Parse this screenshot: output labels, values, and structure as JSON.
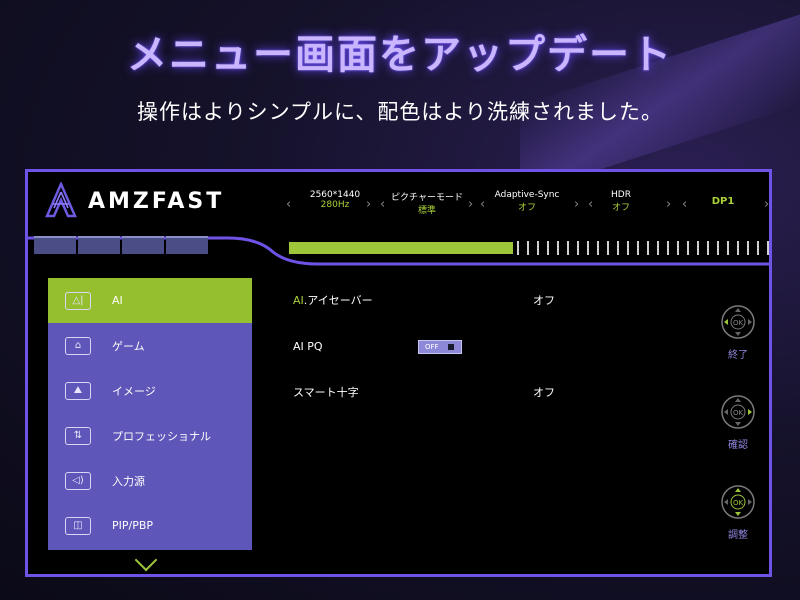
{
  "header": {
    "title": "メニュー画面をアップデート",
    "subtitle": "操作はよりシンプルに、配色はより洗練されました。"
  },
  "osd": {
    "brand": "AMZFAST",
    "status": [
      {
        "top": "2560*1440",
        "sub": "280Hz"
      },
      {
        "top": "ピクチャーモード",
        "sub": "標準"
      },
      {
        "top": "Adaptive-Sync",
        "sub": "オフ"
      },
      {
        "top": "HDR",
        "sub": "オフ"
      },
      {
        "top": "DP1",
        "sub": ""
      }
    ],
    "menu": [
      {
        "label": "AI",
        "icon": "ai-icon",
        "active": true
      },
      {
        "label": "ゲーム",
        "icon": "gamepad-icon",
        "active": false
      },
      {
        "label": "イメージ",
        "icon": "image-icon",
        "active": false
      },
      {
        "label": "プロフェッショナル",
        "icon": "professional-icon",
        "active": false
      },
      {
        "label": "入力源",
        "icon": "input-source-icon",
        "active": false
      },
      {
        "label": "PIP/PBP",
        "icon": "pip-pbp-icon",
        "active": false
      }
    ],
    "settings": [
      {
        "label": "AI.アイセーバー",
        "label_prefix": "AI",
        "label_rest": ".アイセーバー",
        "value": "オフ"
      },
      {
        "label": "AI PQ",
        "value": "OFF"
      },
      {
        "label": "スマート十字",
        "value": "オフ"
      }
    ],
    "controls": [
      {
        "label": "終了",
        "icon": "joystick-exit-icon"
      },
      {
        "label": "確認",
        "icon": "joystick-confirm-icon"
      },
      {
        "label": "調整",
        "icon": "joystick-adjust-icon"
      }
    ],
    "joystick_center": "OK",
    "colors": {
      "accent_green": "#9dc63a",
      "accent_purple": "#6f53e6",
      "menu_bg": "#5e56b8"
    }
  }
}
